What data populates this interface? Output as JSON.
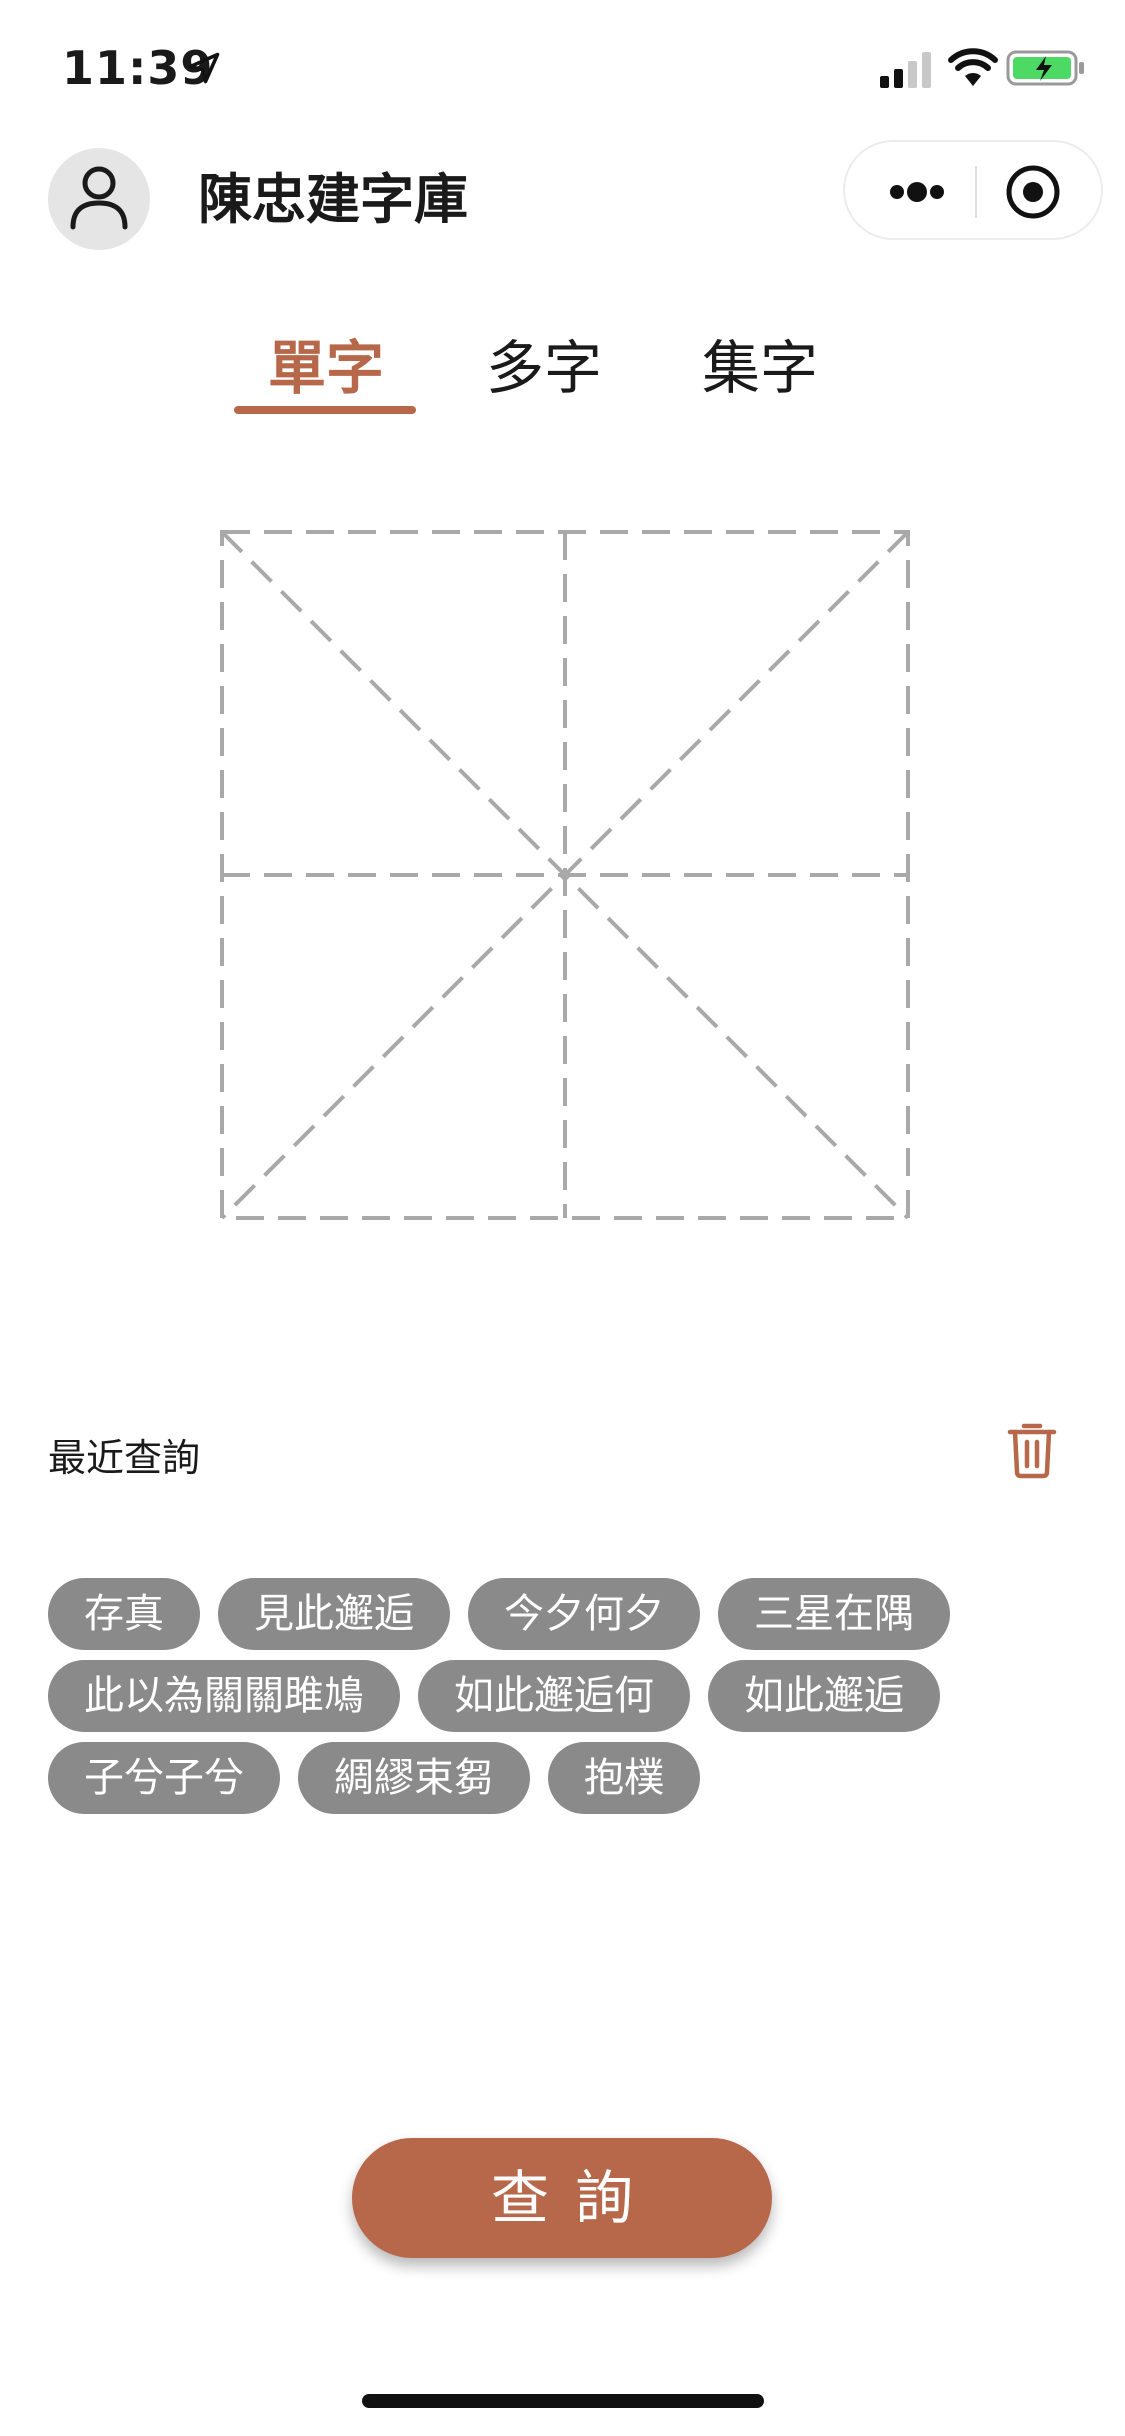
{
  "status_bar": {
    "time": "11:39",
    "icons": [
      "location-arrow-icon",
      "cellular-signal-icon",
      "wifi-icon",
      "battery-charging-icon"
    ]
  },
  "header": {
    "title": "陳忠建字庫",
    "avatar_icon": "user-icon",
    "capsule_icons": [
      "more-icon",
      "close-target-icon"
    ]
  },
  "tabs": {
    "items": [
      "單字",
      "多字",
      "集字"
    ],
    "active_index": 0,
    "accent_color": "#b8684a"
  },
  "writing_grid": {
    "style": "米字格",
    "line_color": "#a9a9a9"
  },
  "recent": {
    "title": "最近查詢",
    "clear_icon": "trash-icon",
    "chips": [
      [
        "存真",
        "見此邂逅",
        "今夕何夕",
        "三星在隅"
      ],
      [
        "此以為關關雎鳩",
        "如此邂逅何",
        "如此邂逅"
      ],
      [
        "子兮子兮",
        "綢繆束芻",
        "抱樸"
      ]
    ],
    "chip_color": "#8a8a8a"
  },
  "query_button": {
    "label": "查詢",
    "color": "#b8684a"
  }
}
